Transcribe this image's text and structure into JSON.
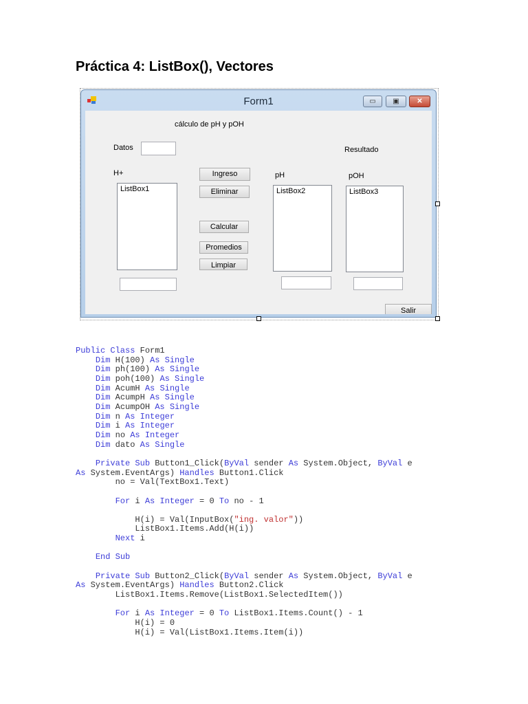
{
  "doc_title": "Práctica 4: ListBox(), Vectores",
  "form": {
    "title": "Form1",
    "heading": "cálculo de pH y pOH",
    "datos_label": "Datos",
    "resultado_label": "Resultado",
    "h_label": "H+",
    "ph_label": "pH",
    "poh_label": "pOH",
    "listbox1": "ListBox1",
    "listbox2": "ListBox2",
    "listbox3": "ListBox3",
    "buttons": {
      "ingreso": "Ingreso",
      "eliminar": "Eliminar",
      "calcular": "Calcular",
      "promedios": "Promedios",
      "limpiar": "Limpiar",
      "salir": "Salir"
    },
    "caption_icons": {
      "minimize": "▭",
      "maximize": "▣",
      "close": "✕"
    }
  },
  "code_lines": [
    [
      [
        "kw",
        "Public Class"
      ],
      [
        "t",
        " Form1"
      ]
    ],
    [
      [
        "t",
        "    "
      ],
      [
        "kw",
        "Dim"
      ],
      [
        "t",
        " H(100) "
      ],
      [
        "kw",
        "As Single"
      ]
    ],
    [
      [
        "t",
        "    "
      ],
      [
        "kw",
        "Dim"
      ],
      [
        "t",
        " ph(100) "
      ],
      [
        "kw",
        "As Single"
      ]
    ],
    [
      [
        "t",
        "    "
      ],
      [
        "kw",
        "Dim"
      ],
      [
        "t",
        " poh(100) "
      ],
      [
        "kw",
        "As Single"
      ]
    ],
    [
      [
        "t",
        "    "
      ],
      [
        "kw",
        "Dim"
      ],
      [
        "t",
        " AcumH "
      ],
      [
        "kw",
        "As Single"
      ]
    ],
    [
      [
        "t",
        "    "
      ],
      [
        "kw",
        "Dim"
      ],
      [
        "t",
        " AcumpH "
      ],
      [
        "kw",
        "As Single"
      ]
    ],
    [
      [
        "t",
        "    "
      ],
      [
        "kw",
        "Dim"
      ],
      [
        "t",
        " AcumpOH "
      ],
      [
        "kw",
        "As Single"
      ]
    ],
    [
      [
        "t",
        "    "
      ],
      [
        "kw",
        "Dim"
      ],
      [
        "t",
        " n "
      ],
      [
        "kw",
        "As Integer"
      ]
    ],
    [
      [
        "t",
        "    "
      ],
      [
        "kw",
        "Dim"
      ],
      [
        "t",
        " i "
      ],
      [
        "kw",
        "As Integer"
      ]
    ],
    [
      [
        "t",
        "    "
      ],
      [
        "kw",
        "Dim"
      ],
      [
        "t",
        " no "
      ],
      [
        "kw",
        "As Integer"
      ]
    ],
    [
      [
        "t",
        "    "
      ],
      [
        "kw",
        "Dim"
      ],
      [
        "t",
        " dato "
      ],
      [
        "kw",
        "As Single"
      ]
    ],
    [],
    [
      [
        "t",
        "    "
      ],
      [
        "kw",
        "Private Sub"
      ],
      [
        "t",
        " Button1_Click("
      ],
      [
        "kw",
        "ByVal"
      ],
      [
        "t",
        " sender "
      ],
      [
        "kw",
        "As"
      ],
      [
        "t",
        " System.Object, "
      ],
      [
        "kw",
        "ByVal"
      ],
      [
        "t",
        " e"
      ]
    ],
    [
      [
        "kw",
        "As"
      ],
      [
        "t",
        " System.EventArgs) "
      ],
      [
        "kw",
        "Handles"
      ],
      [
        "t",
        " Button1.Click"
      ]
    ],
    [
      [
        "t",
        "        no = Val(TextBox1.Text)"
      ]
    ],
    [],
    [
      [
        "t",
        "        "
      ],
      [
        "kw",
        "For"
      ],
      [
        "t",
        " i "
      ],
      [
        "kw",
        "As Integer"
      ],
      [
        "t",
        " = 0 "
      ],
      [
        "kw",
        "To"
      ],
      [
        "t",
        " no - 1"
      ]
    ],
    [],
    [
      [
        "t",
        "            H(i) = Val(InputBox("
      ],
      [
        "str",
        "\"ing. valor\""
      ],
      [
        "t",
        "))"
      ]
    ],
    [
      [
        "t",
        "            ListBox1.Items.Add(H(i))"
      ]
    ],
    [
      [
        "t",
        "        "
      ],
      [
        "kw",
        "Next"
      ],
      [
        "t",
        " i"
      ]
    ],
    [],
    [
      [
        "t",
        "    "
      ],
      [
        "kw",
        "End Sub"
      ]
    ],
    [],
    [
      [
        "t",
        "    "
      ],
      [
        "kw",
        "Private Sub"
      ],
      [
        "t",
        " Button2_Click("
      ],
      [
        "kw",
        "ByVal"
      ],
      [
        "t",
        " sender "
      ],
      [
        "kw",
        "As"
      ],
      [
        "t",
        " System.Object, "
      ],
      [
        "kw",
        "ByVal"
      ],
      [
        "t",
        " e"
      ]
    ],
    [
      [
        "kw",
        "As"
      ],
      [
        "t",
        " System.EventArgs) "
      ],
      [
        "kw",
        "Handles"
      ],
      [
        "t",
        " Button2.Click"
      ]
    ],
    [
      [
        "t",
        "        ListBox1.Items.Remove(ListBox1.SelectedItem())"
      ]
    ],
    [],
    [
      [
        "t",
        "        "
      ],
      [
        "kw",
        "For"
      ],
      [
        "t",
        " i "
      ],
      [
        "kw",
        "As Integer"
      ],
      [
        "t",
        " = 0 "
      ],
      [
        "kw",
        "To"
      ],
      [
        "t",
        " ListBox1.Items.Count() - 1"
      ]
    ],
    [
      [
        "t",
        "            H(i) = 0"
      ]
    ],
    [
      [
        "t",
        "            H(i) = Val(ListBox1.Items.Item(i))"
      ]
    ]
  ]
}
